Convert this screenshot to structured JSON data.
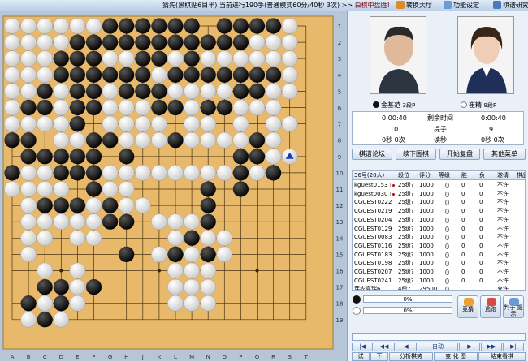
{
  "titlebar": {
    "game_title": "猜先(黑棋贴6目半) 当前进行190手(普通模式60分/40秒 3次)",
    "arrows": ">>",
    "status": "白棋中盘胜!",
    "buttons": [
      {
        "label": "转换大厅",
        "icon": "hall-icon"
      },
      {
        "label": "功能设定",
        "icon": "settings-icon"
      },
      {
        "label": "棋谱研究",
        "icon": "research-icon"
      }
    ]
  },
  "board": {
    "size": 19,
    "col_labels": [
      "A",
      "B",
      "C",
      "D",
      "E",
      "F",
      "G",
      "H",
      "J",
      "K",
      "L",
      "M",
      "N",
      "O",
      "P",
      "Q",
      "R",
      "S",
      "T"
    ],
    "row_labels": [
      "1",
      "2",
      "3",
      "4",
      "5",
      "6",
      "7",
      "8",
      "9",
      "10",
      "11",
      "12",
      "13",
      "14",
      "15",
      "16",
      "17",
      "18",
      "19"
    ],
    "last_move_marker": "triangle-icon",
    "black_stones": [
      "C19",
      "B18",
      "D18",
      "C17",
      "D17",
      "F17",
      "H15",
      "L15",
      "M14",
      "N15",
      "C12",
      "D12",
      "E12",
      "G12",
      "G13",
      "H13",
      "F11",
      "N11",
      "N12",
      "N13",
      "P11",
      "P10",
      "P9",
      "Q9",
      "Q10",
      "R10",
      "A10",
      "C10",
      "D10",
      "E10",
      "F10",
      "B9",
      "C9",
      "D9",
      "E9",
      "F9",
      "H9",
      "A8",
      "B8",
      "F8",
      "G8",
      "Q8",
      "E7",
      "L8",
      "B6",
      "C6",
      "E6",
      "F6",
      "K6",
      "L6",
      "N6",
      "O6",
      "C5",
      "E5",
      "F5",
      "H5",
      "J5",
      "K5",
      "P5",
      "Q5",
      "D4",
      "E4",
      "F4",
      "G4",
      "H4",
      "J4",
      "L4",
      "M4",
      "N4",
      "O4",
      "P4",
      "Q4",
      "R4",
      "D3",
      "E3",
      "F3",
      "J3",
      "K3",
      "M3",
      "E2",
      "F2",
      "G2",
      "H2",
      "J2",
      "K2",
      "L2",
      "M2",
      "N2",
      "O2",
      "P2",
      "G1",
      "H1",
      "J1",
      "K1",
      "L1",
      "M1",
      "O1",
      "P1",
      "Q1",
      "R1"
    ],
    "white_stones": [
      "B19",
      "D19",
      "C18",
      "E18",
      "C16",
      "E17",
      "E16",
      "L18",
      "M18",
      "N18",
      "L17",
      "M17",
      "N17",
      "L16",
      "M16",
      "N16",
      "K15",
      "M15",
      "O15",
      "L14",
      "N14",
      "O14",
      "K13",
      "L13",
      "M13",
      "B13",
      "C13",
      "D13",
      "B14",
      "C14",
      "E14",
      "F14",
      "B15",
      "E13",
      "F13",
      "H12",
      "J12",
      "F12",
      "B12",
      "C11",
      "D11",
      "G11",
      "H11",
      "A11",
      "B11",
      "C10",
      "Q10",
      "B10",
      "G10",
      "H10",
      "J10",
      "K10",
      "L10",
      "M10",
      "N10",
      "O10",
      "R9",
      "S9",
      "R8",
      "R7",
      "S7",
      "D8",
      "E8",
      "H8",
      "J8",
      "K8",
      "M8",
      "N8",
      "O8",
      "P8",
      "J7",
      "K7",
      "M7",
      "N7",
      "P7",
      "R6",
      "D7",
      "C7",
      "A7",
      "B7",
      "G7",
      "H7",
      "A6",
      "D6",
      "G6",
      "H6",
      "J6",
      "M6",
      "P6",
      "Q6",
      "A5",
      "B5",
      "D5",
      "G5",
      "L5",
      "M5",
      "N5",
      "O5",
      "R5",
      "S5",
      "A4",
      "B4",
      "C4",
      "K4",
      "S4",
      "A3",
      "B3",
      "C3",
      "G3",
      "H3",
      "L3",
      "N3",
      "O3",
      "P3",
      "Q3",
      "R3",
      "S3",
      "A2",
      "B2",
      "C2",
      "D2",
      "Q2",
      "R2",
      "S2",
      "A1",
      "B1",
      "C1",
      "D1",
      "E1",
      "F1",
      "S1"
    ],
    "last_move": "S9"
  },
  "players": {
    "black": {
      "name": "金基范",
      "rank": "3段P"
    },
    "white": {
      "name": "崔精",
      "rank": "9段P"
    }
  },
  "stats": {
    "time_black": "0:00:40",
    "time_label": "剩余时间",
    "time_white": "0:00:40",
    "captures_black": "10",
    "captures_label": "提子",
    "captures_white": "9",
    "byo_black": "0秒 0次",
    "byo_label": "读秒",
    "byo_white": "0秒 0次"
  },
  "action_buttons": [
    "棋谱论坛",
    "续下围棋",
    "开始复盘",
    "其他菜单"
  ],
  "viewers": {
    "headers": [
      "36号(20人)",
      "段位",
      "评分",
      "等级",
      "胜",
      "负",
      "邀请",
      "棋品"
    ],
    "rows": [
      {
        "name": "kguest0153",
        "rank": "25级?",
        "score": "1000",
        "win": "0",
        "loss": "0",
        "invite": "不许"
      },
      {
        "name": "kguest0030",
        "rank": "25级?",
        "score": "1000",
        "win": "0",
        "loss": "0",
        "invite": "不许"
      },
      {
        "name": "CGUEST0222",
        "rank": "25级?",
        "score": "1000",
        "win": "0",
        "loss": "0",
        "invite": "不许"
      },
      {
        "name": "CGUEST0219",
        "rank": "25级?",
        "score": "1000",
        "win": "0",
        "loss": "0",
        "invite": "不许"
      },
      {
        "name": "CGUEST0204",
        "rank": "25级?",
        "score": "1000",
        "win": "0",
        "loss": "0",
        "invite": "不许"
      },
      {
        "name": "CGUEST0129",
        "rank": "25级?",
        "score": "1000",
        "win": "0",
        "loss": "0",
        "invite": "不许"
      },
      {
        "name": "CGUEST0083",
        "rank": "25级?",
        "score": "1000",
        "win": "0",
        "loss": "0",
        "invite": "不许"
      },
      {
        "name": "CGUEST0116",
        "rank": "25级?",
        "score": "1000",
        "win": "0",
        "loss": "0",
        "invite": "不许"
      },
      {
        "name": "CGUEST0183",
        "rank": "25级?",
        "score": "1000",
        "win": "0",
        "loss": "0",
        "invite": "不许"
      },
      {
        "name": "CGUEST0198",
        "rank": "25级?",
        "score": "1000",
        "win": "0",
        "loss": "0",
        "invite": "不许"
      },
      {
        "name": "CGUEST0207",
        "rank": "25级?",
        "score": "1000",
        "win": "0",
        "loss": "0",
        "invite": "不许"
      },
      {
        "name": "CGUEST0241",
        "rank": "25级?",
        "score": "1000",
        "win": "0",
        "loss": "0",
        "invite": "不许"
      },
      {
        "name": "芽农喜瑞6",
        "rank": "4段?",
        "score": "29500",
        "win": "",
        "loss": "",
        "invite": "允许"
      }
    ]
  },
  "bars": {
    "black_pct": "0%",
    "white_pct": "0%"
  },
  "side_buttons": [
    "竞猜",
    "逃跑",
    "判子 提示"
  ],
  "nav_buttons": [
    "|◀",
    "◀◀",
    "◀",
    "自动",
    "▶",
    "▶▶",
    "▶|"
  ],
  "bottom_buttons": [
    "试",
    "下",
    "分析棋势",
    "变 化 图",
    "结束看棋"
  ],
  "colors": {
    "board": "#e8b96a",
    "accent": "#7a0000",
    "panel": "#eaf0f8"
  }
}
